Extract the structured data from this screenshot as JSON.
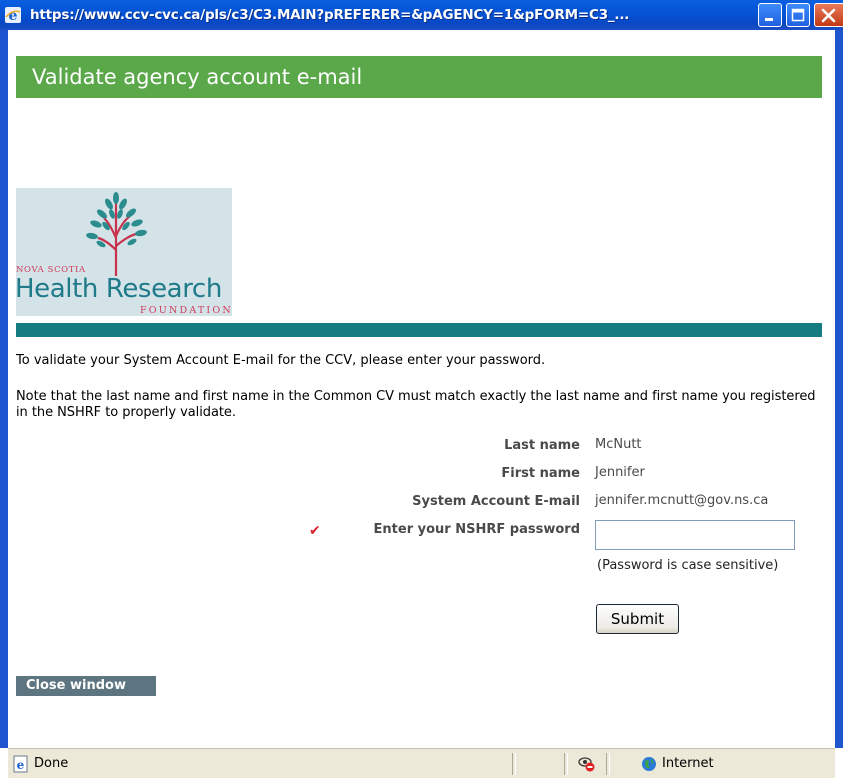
{
  "window": {
    "title": "https://www.ccv-cvc.ca/pls/c3/C3.MAIN?pREFERER=&pAGENCY=1&pFORM=C3_...",
    "buttons": [
      "minimize",
      "maximize",
      "close"
    ]
  },
  "header": {
    "title": "Validate agency account e-mail"
  },
  "logo": {
    "line1": "NOVA SCOTIA",
    "line2": "Health Research",
    "line3": "FOUNDATION"
  },
  "intro": {
    "p1": "To validate your System Account E-mail for the CCV, please enter your password.",
    "p2": "Note that the last name and first name in the Common CV must match exactly the last name and first name you registered in the NSHRF to properly validate."
  },
  "form": {
    "last_name_label": "Last name",
    "last_name_value": "McNutt",
    "first_name_label": "First name",
    "first_name_value": "Jennifer",
    "email_label": "System Account E-mail",
    "email_value": "jennifer.mcnutt@gov.ns.ca",
    "password_label": "Enter your NSHRF password",
    "password_value": "",
    "password_hint": "(Password is case sensitive)",
    "submit_label": "Submit"
  },
  "close_window_label": "Close window",
  "statusbar": {
    "status": "Done",
    "zone": "Internet"
  },
  "colors": {
    "header_green": "#5aa84a",
    "teal_bar": "#157c82",
    "xp_blue": "#0453d4",
    "close_button": "#5d7580",
    "required_mark": "#d8202f"
  },
  "icons": [
    "ie-icon",
    "minimize-icon",
    "maximize-icon",
    "close-icon",
    "required-check-icon",
    "page-icon",
    "privacy-icon",
    "globe-icon"
  ]
}
